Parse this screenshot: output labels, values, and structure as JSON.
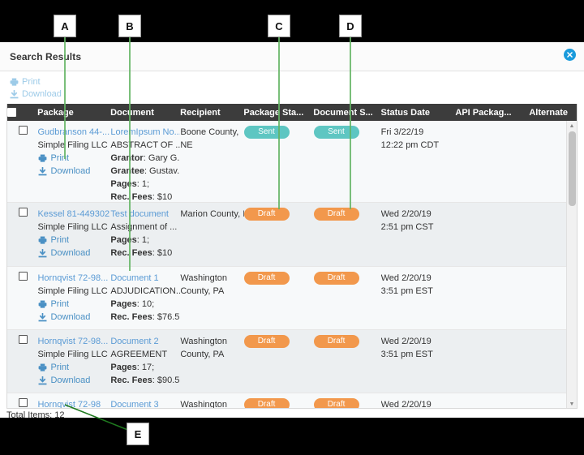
{
  "callouts": [
    {
      "label": "A"
    },
    {
      "label": "B"
    },
    {
      "label": "C"
    },
    {
      "label": "D"
    },
    {
      "label": "E"
    }
  ],
  "window": {
    "title": "Search Results",
    "close_icon": "close-circle-icon"
  },
  "toolbar": {
    "print_label": "Print",
    "print_icon": "printer-icon",
    "download_label": "Download",
    "download_icon": "download-icon"
  },
  "table": {
    "columns": [
      {
        "key": "check",
        "label": ""
      },
      {
        "key": "package",
        "label": "Package"
      },
      {
        "key": "document",
        "label": "Document"
      },
      {
        "key": "recipient",
        "label": "Recipient"
      },
      {
        "key": "package_status",
        "label": "Package Sta..."
      },
      {
        "key": "document_status",
        "label": "Document S..."
      },
      {
        "key": "status_date",
        "label": "Status Date"
      },
      {
        "key": "api_package",
        "label": "API Packag..."
      },
      {
        "key": "alternate",
        "label": "Alternate"
      }
    ],
    "rows": [
      {
        "package_name": "Gudbranson 44-...",
        "package_org": "Simple Filing LLC",
        "print_label": "Print",
        "download_label": "Download",
        "document_name": "LoremIpsum No...",
        "document_type": "ABSTRACT OF ...",
        "detail_1_key": "Grantor",
        "detail_1_val": ": Gary G...",
        "detail_2_key": "Grantee",
        "detail_2_val": ": Gustav...",
        "pages_key": "Pages",
        "pages_val": ": 1;",
        "fees_key": "Rec. Fees",
        "fees_val": ": $10",
        "recipient_line1": "Boone County,",
        "recipient_line2": "NE",
        "package_status": "Sent",
        "document_status": "Sent",
        "status_date": "Fri 3/22/19",
        "status_time": "12:22 pm CDT",
        "api_package": "",
        "alternate": ""
      },
      {
        "package_name": "Kessel 81-449302",
        "package_org": "Simple Filing LLC",
        "print_label": "Print",
        "download_label": "Download",
        "document_name": "Test document",
        "document_type": "Assignment of ...",
        "pages_key": "Pages",
        "pages_val": ": 1;",
        "fees_key": "Rec. Fees",
        "fees_val": ": $10",
        "recipient_line1": "Marion County, IA",
        "recipient_line2": "",
        "package_status": "Draft",
        "document_status": "Draft",
        "status_date": "Wed 2/20/19",
        "status_time": "2:51 pm CST",
        "api_package": "",
        "alternate": ""
      },
      {
        "package_name": "Hornqvist 72-98...",
        "package_org": "Simple Filing LLC",
        "print_label": "Print",
        "download_label": "Download",
        "document_name": "Document 1",
        "document_type": "ADJUDICATION...",
        "pages_key": "Pages",
        "pages_val": ": 10;",
        "fees_key": "Rec. Fees",
        "fees_val": ": $76.5",
        "recipient_line1": "Washington",
        "recipient_line2": "County, PA",
        "package_status": "Draft",
        "document_status": "Draft",
        "status_date": "Wed 2/20/19",
        "status_time": "3:51 pm EST",
        "api_package": "",
        "alternate": ""
      },
      {
        "package_name": "Hornqvist 72-98...",
        "package_org": "Simple Filing LLC",
        "print_label": "Print",
        "download_label": "Download",
        "document_name": "Document 2",
        "document_type": "AGREEMENT",
        "pages_key": "Pages",
        "pages_val": ": 17;",
        "fees_key": "Rec. Fees",
        "fees_val": ": $90.5",
        "recipient_line1": "Washington",
        "recipient_line2": "County, PA",
        "package_status": "Draft",
        "document_status": "Draft",
        "status_date": "Wed 2/20/19",
        "status_time": "3:51 pm EST",
        "api_package": "",
        "alternate": ""
      },
      {
        "package_name": "Hornqvist 72-98",
        "package_org": "",
        "print_label": "",
        "download_label": "",
        "document_name": "Document 3",
        "document_type": "",
        "pages_key": "",
        "pages_val": "",
        "fees_key": "",
        "fees_val": "",
        "recipient_line1": "Washington",
        "recipient_line2": "",
        "package_status": "Draft",
        "document_status": "Draft",
        "status_date": "Wed 2/20/19",
        "status_time": "",
        "api_package": "",
        "alternate": ""
      }
    ]
  },
  "footer": {
    "total_items": "Total Items: 12"
  },
  "colors": {
    "badge_sent": "#5ec6c2",
    "badge_draft": "#f2984c",
    "link": "#5b9bd5",
    "header_bg": "#3c3c3c",
    "callout_line": "#63b463",
    "close": "#1a9bdc"
  }
}
